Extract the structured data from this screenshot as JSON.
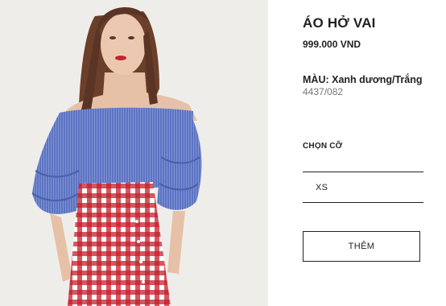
{
  "product": {
    "name": "ÁO HỞ VAI",
    "price": "999.000 VND",
    "color_label": "MÀU:",
    "color_value": "Xanh dương/Trắng",
    "reference": "4437/082"
  },
  "size_picker": {
    "label": "CHỌN CỠ",
    "options": [
      "XS"
    ]
  },
  "actions": {
    "add_label": "THÊM"
  },
  "palette": {
    "photo_background": "#efedea",
    "blouse_blue": "#5c74c2",
    "skirt_red": "#c41f2a",
    "text": "#222222",
    "muted_text": "#777777"
  }
}
